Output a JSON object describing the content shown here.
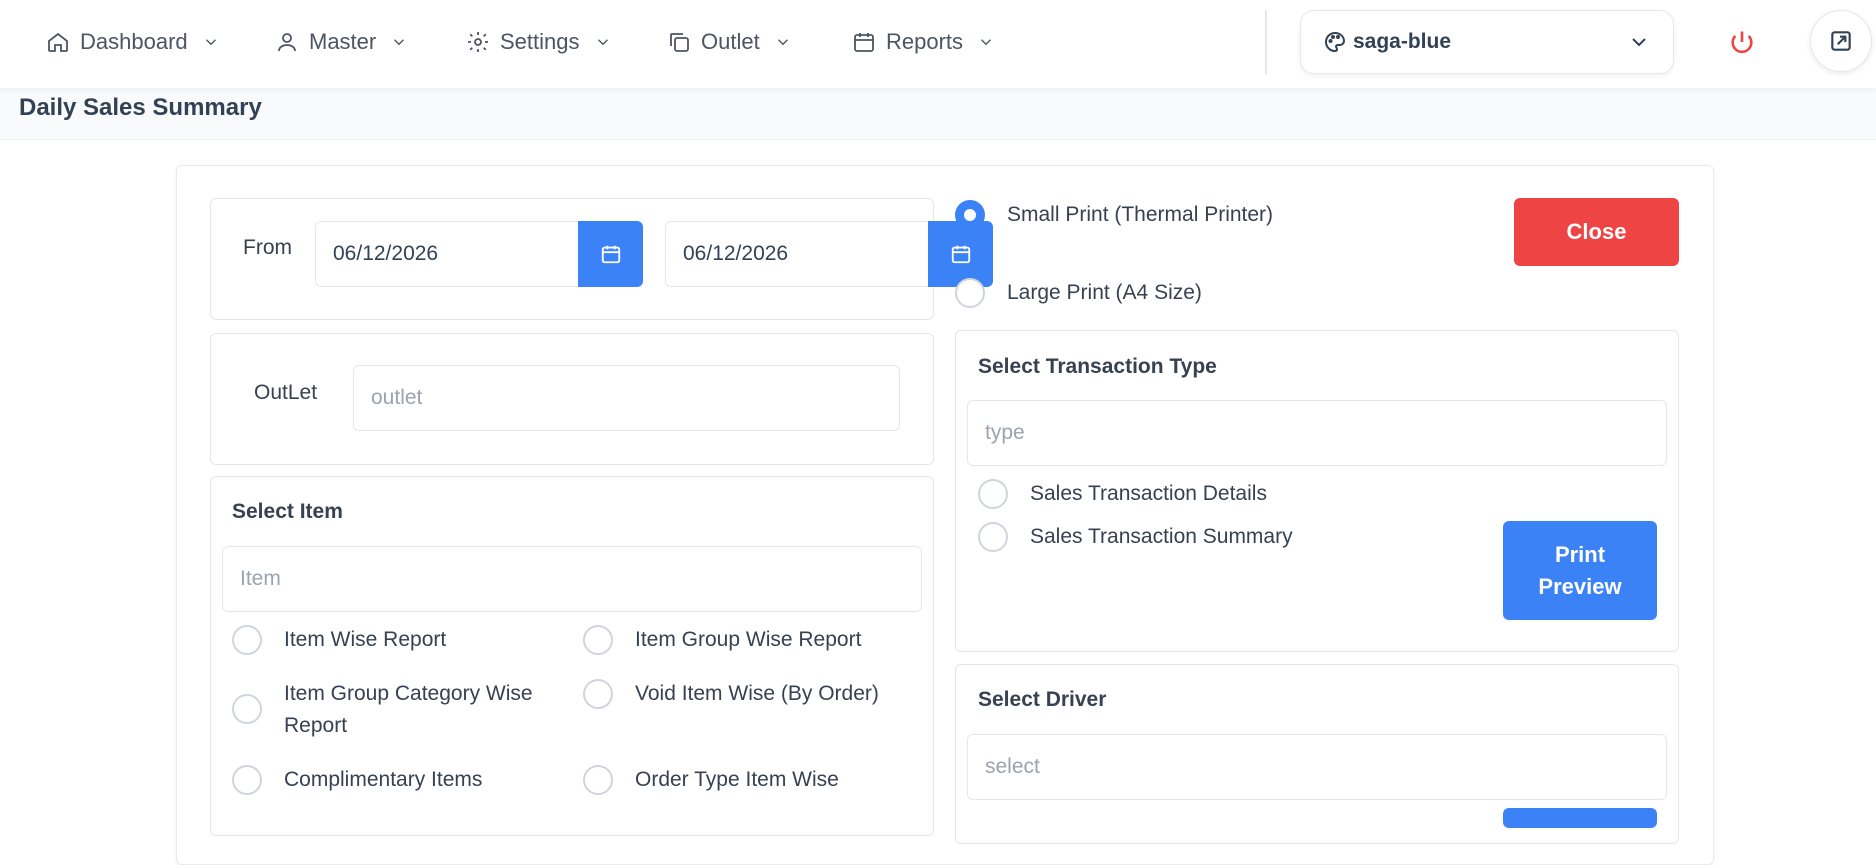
{
  "nav": {
    "items": [
      {
        "label": "Dashboard",
        "icon": "home-icon"
      },
      {
        "label": "Master",
        "icon": "user-icon"
      },
      {
        "label": "Settings",
        "icon": "gear-icon"
      },
      {
        "label": "Outlet",
        "icon": "copy-icon"
      },
      {
        "label": "Reports",
        "icon": "calendar-icon"
      }
    ],
    "theme": "saga-blue"
  },
  "page": {
    "title": "Daily Sales Summary"
  },
  "date_range": {
    "label": "From",
    "from_value": "06/12/2026",
    "to_value": "06/12/2026"
  },
  "outlet": {
    "label": "OutLet",
    "placeholder": "outlet"
  },
  "item": {
    "title": "Select Item",
    "placeholder": "Item",
    "options": [
      "Item Wise Report",
      "Item Group Wise Report",
      "Item Group Category Wise Report",
      "Void Item Wise (By Order)",
      "Complimentary Items",
      "Order Type Item Wise"
    ]
  },
  "print": {
    "options": [
      "Small Print (Thermal Printer)",
      "Large Print (A4 Size)"
    ],
    "selected": "Small Print (Thermal Printer)"
  },
  "buttons": {
    "close": "Close",
    "print_preview": "Print Preview"
  },
  "transaction": {
    "title": "Select Transaction Type",
    "placeholder": "type",
    "options": [
      "Sales Transaction Details",
      "Sales Transaction Summary"
    ]
  },
  "driver": {
    "title": "Select Driver",
    "placeholder": "select"
  },
  "colors": {
    "primary": "#3b82f6",
    "danger": "#ef4444"
  }
}
